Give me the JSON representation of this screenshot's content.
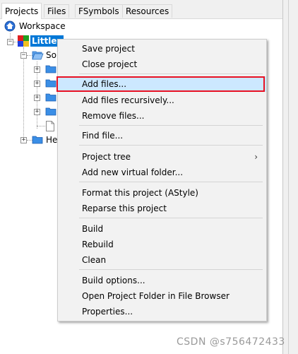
{
  "tabs": [
    {
      "label": "Projects"
    },
    {
      "label": "Files"
    },
    {
      "label": "FSymbols"
    },
    {
      "label": "Resources"
    }
  ],
  "tree": {
    "workspace": "Workspace",
    "project": "Littlev",
    "sources_folder": "So",
    "headers_folder": "He"
  },
  "menu": {
    "items": [
      {
        "label": "Save project"
      },
      {
        "label": "Close project"
      },
      {
        "label": "Add files..."
      },
      {
        "label": "Add files recursively..."
      },
      {
        "label": "Remove files..."
      },
      {
        "label": "Find file..."
      },
      {
        "label": "Project tree"
      },
      {
        "label": "Add new virtual folder..."
      },
      {
        "label": "Format this project (AStyle)"
      },
      {
        "label": "Reparse this project"
      },
      {
        "label": "Build"
      },
      {
        "label": "Rebuild"
      },
      {
        "label": "Clean"
      },
      {
        "label": "Build options..."
      },
      {
        "label": "Open Project Folder in File Browser"
      },
      {
        "label": "Properties..."
      }
    ],
    "submenu_arrow": "›"
  },
  "watermark": "CSDN @s756472433",
  "colors": {
    "selection": "#0078d7",
    "menu_bg": "#f2f2f2",
    "highlight": "#cce8ff",
    "highlight_border": "#e81123",
    "folder": "#3a8ee6"
  }
}
